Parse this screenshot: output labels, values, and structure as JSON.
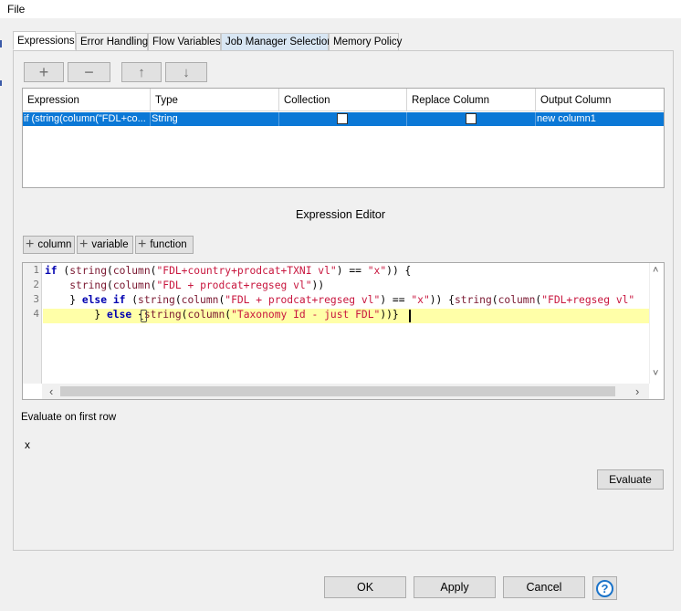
{
  "menu": {
    "file": "File"
  },
  "tabs": [
    {
      "label": "Expressions",
      "active": true
    },
    {
      "label": "Error Handling",
      "active": false
    },
    {
      "label": "Flow Variables",
      "active": false
    },
    {
      "label": "Job Manager Selection",
      "active": false
    },
    {
      "label": "Memory Policy",
      "active": false
    }
  ],
  "toolbar": {
    "add_icon": "+",
    "remove_icon": "−",
    "up_icon": "↑",
    "down_icon": "↓"
  },
  "table": {
    "headers": [
      "Expression",
      "Type",
      "Collection",
      "Replace Column",
      "Output Column"
    ],
    "rows": [
      {
        "expression": "if (string(column(\"FDL+co...",
        "type": "String",
        "collection": false,
        "replace_column": false,
        "output_column": "new column1"
      }
    ]
  },
  "editor": {
    "title": "Expression Editor",
    "insert_buttons": {
      "column": "column",
      "variable": "variable",
      "function": "function"
    },
    "line_numbers": [
      "1",
      "2",
      "3",
      "4"
    ],
    "lines": {
      "l1": {
        "a": "if",
        "b": " (",
        "c": "string",
        "d": "(",
        "e": "column",
        "f": "(",
        "g": "\"FDL+country+prodcat+TXNI vl\"",
        "h": ") == ",
        "i": "\"x\"",
        "j": ")) {"
      },
      "l2": {
        "a": "    ",
        "b": "string",
        "c": "(",
        "d": "column",
        "e": "(",
        "f": "\"FDL + prodcat+regseg vl\"",
        "g": "))"
      },
      "l3": {
        "a": "    } ",
        "b": "else if",
        "c": " (",
        "d": "string",
        "e": "(",
        "f": "column",
        "g": "(",
        "h": "\"FDL + prodcat+regseg vl\"",
        "i": ") == ",
        "j": "\"x\"",
        "k": ")) {",
        "l": "string",
        "m": "(",
        "n": "column",
        "o": "(",
        "p": "\"FDL+regseg vl\""
      },
      "l4": {
        "a": "        } ",
        "b": "else",
        "c": " {",
        "d": "string",
        "e": "(",
        "f": "column",
        "g": "(",
        "h": "\"Taxonomy Id - just FDL\"",
        "i": "))}"
      }
    }
  },
  "evaluation": {
    "label": "Evaluate on first row",
    "result": "x",
    "button": "Evaluate"
  },
  "dialog_buttons": {
    "ok": "OK",
    "apply": "Apply",
    "cancel": "Cancel",
    "help": "?"
  },
  "colors": {
    "selection": "#0b78d6",
    "keyword": "#0000b0",
    "string": "#c8163e",
    "current_line": "#ffffa8"
  }
}
